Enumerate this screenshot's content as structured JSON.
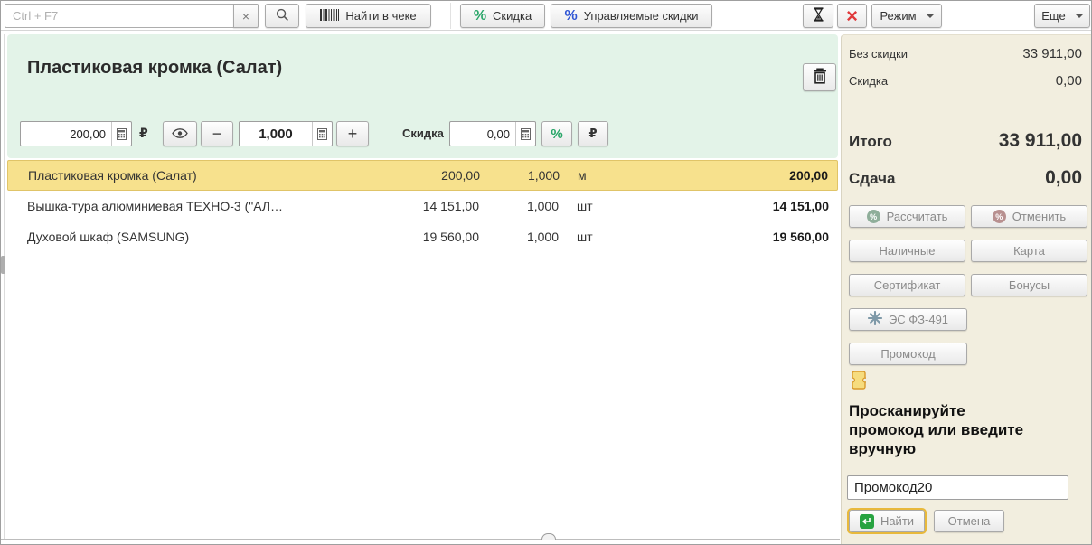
{
  "toolbar": {
    "search_placeholder": "Ctrl + F7",
    "clear_label": "×",
    "find_in_receipt": "Найти в чеке",
    "discount": "Скидка",
    "managed_discounts": "Управляемые скидки",
    "close_label": "×",
    "mode": "Режим",
    "more": "Еще"
  },
  "product": {
    "title": "Пластиковая кромка (Салат)",
    "price_value": "200,00",
    "currency": "₽",
    "minus": "−",
    "qty_value": "1,000",
    "plus": "+",
    "discount_label": "Скидка",
    "discount_value": "0,00",
    "percent": "%",
    "ruble": "₽"
  },
  "table": {
    "rows": [
      {
        "name": "Пластиковая кромка (Салат)",
        "price": "200,00",
        "qty": "1,000",
        "unit": "м",
        "total": "200,00",
        "selected": true
      },
      {
        "name": "Вышка-тура алюминиевая ТЕХНО-3 (\"АЛ…",
        "price": "14 151,00",
        "qty": "1,000",
        "unit": "шт",
        "total": "14 151,00",
        "selected": false
      },
      {
        "name": "Духовой шкаф (SAMSUNG)",
        "price": "19 560,00",
        "qty": "1,000",
        "unit": "шт",
        "total": "19 560,00",
        "selected": false
      }
    ]
  },
  "summary": {
    "no_discount_label": "Без скидки",
    "no_discount_value": "33 911,00",
    "discount_label": "Скидка",
    "discount_value": "0,00",
    "total_label": "Итого",
    "total_value": "33 911,00",
    "change_label": "Сдача",
    "change_value": "0,00"
  },
  "payment": {
    "calculate": "Рассчитать",
    "cancel": "Отменить",
    "cash": "Наличные",
    "card": "Карта",
    "certificate": "Сертификат",
    "bonuses": "Бонусы",
    "es_fz": "ЭС ФЗ-491",
    "promocode": "Промокод",
    "percent_badge": "%"
  },
  "promo": {
    "hint": "Просканируйте промокод или введите вручную",
    "input_value": "Промокод20",
    "find": "Найти",
    "cancel": "Отмена"
  },
  "colors": {
    "accent_green": "#27a567",
    "accent_blue": "#2f55d4",
    "close_red": "#e0393b",
    "selected_row": "#f7e18d",
    "product_panel": "#e3f3e8",
    "pay_panel": "#f2eedf",
    "focus_ring": "#e8b93c"
  }
}
